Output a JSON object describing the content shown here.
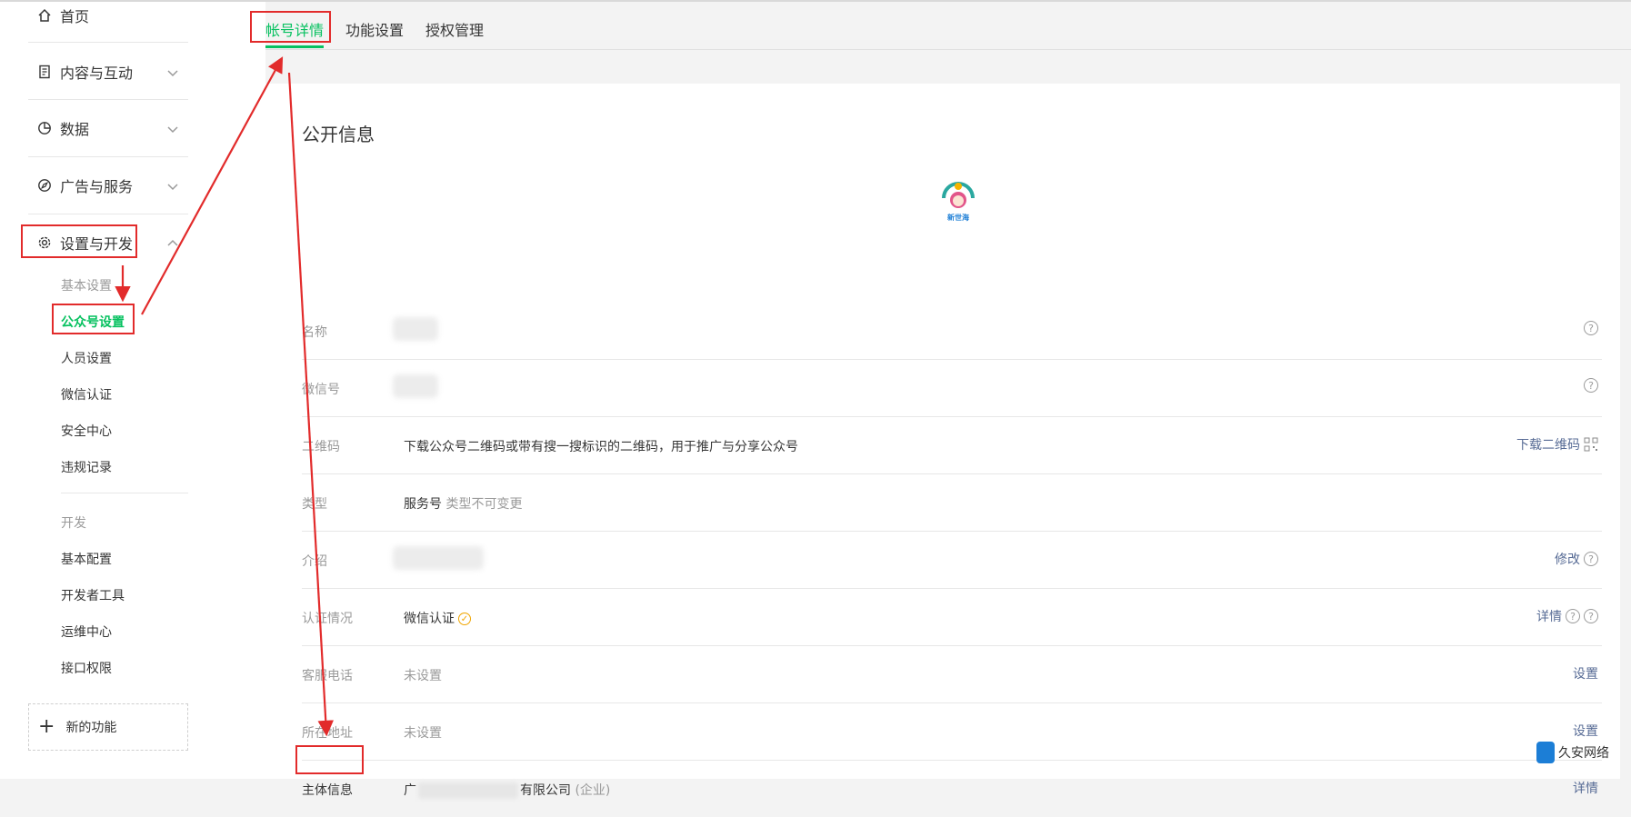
{
  "sidebar": {
    "home": "首页",
    "content": "内容与互动",
    "data": "数据",
    "ads": "广告与服务",
    "settings": "设置与开发",
    "basic_settings_header": "基本设置",
    "account_settings": "公众号设置",
    "staff_settings": "人员设置",
    "wechat_verify": "微信认证",
    "security_center": "安全中心",
    "violations": "违规记录",
    "dev_header": "开发",
    "basic_config": "基本配置",
    "dev_tools": "开发者工具",
    "ops_center": "运维中心",
    "api_permissions": "接口权限",
    "new_features": "新的功能"
  },
  "tabs": [
    "帐号详情",
    "功能设置",
    "授权管理"
  ],
  "main": {
    "title": "公开信息",
    "avatar_text": "新世海",
    "rows": {
      "name": {
        "label": "名称"
      },
      "wechat_id": {
        "label": "微信号"
      },
      "qrcode": {
        "label": "二维码",
        "value": "下载公众号二维码或带有搜一搜标识的二维码，用于推广与分享公众号",
        "action": "下载二维码"
      },
      "type": {
        "label": "类型",
        "value": "服务号",
        "note": "类型不可变更"
      },
      "intro": {
        "label": "介绍",
        "action": "修改"
      },
      "verification": {
        "label": "认证情况",
        "value": "微信认证",
        "action": "详情"
      },
      "phone": {
        "label": "客服电话",
        "value": "未设置",
        "action": "设置"
      },
      "address": {
        "label": "所在地址",
        "value": "未设置",
        "action": "设置"
      },
      "entity": {
        "label": "主体信息",
        "value_prefix": "广",
        "value_suffix": "有限公司",
        "value_type": "(企业)",
        "action": "详情"
      }
    }
  },
  "watermark": "久安网络",
  "colors": {
    "accent": "#07c160",
    "link": "#576b95",
    "annotation": "#e22b2b"
  }
}
